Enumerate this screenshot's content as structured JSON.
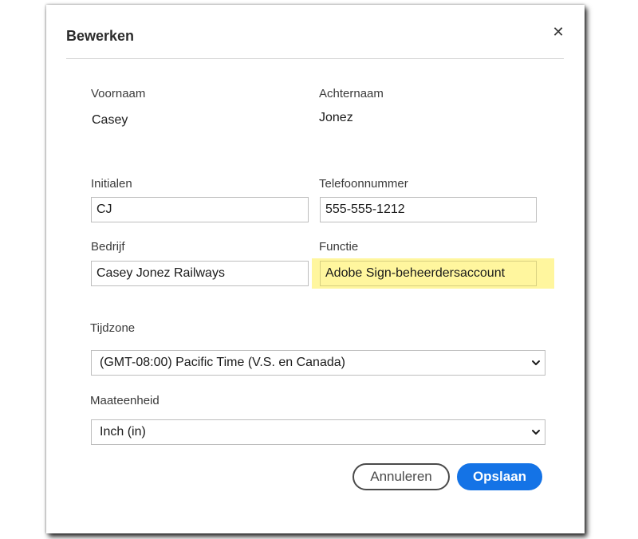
{
  "dialog": {
    "title": "Bewerken",
    "close_glyph": "✕"
  },
  "form": {
    "first_name": {
      "label": "Voornaam",
      "value": "Casey"
    },
    "last_name": {
      "label": "Achternaam",
      "value": "Jonez"
    },
    "initials": {
      "label": "Initialen",
      "value": "CJ"
    },
    "phone": {
      "label": "Telefoonnummer",
      "value": "555-555-1212"
    },
    "company": {
      "label": "Bedrijf",
      "value": "Casey Jonez Railways"
    },
    "job_title": {
      "label": "Functie",
      "value": "Adobe Sign-beheerdersaccount"
    },
    "timezone": {
      "label": "Tijdzone",
      "value": "(GMT-08:00) Pacific Time (V.S. en Canada)"
    },
    "unit": {
      "label": "Maateenheid",
      "value": "Inch (in)"
    }
  },
  "buttons": {
    "cancel_label": "Annuleren",
    "save_label": "Opslaan"
  },
  "colors": {
    "accent": "#1473e6",
    "highlight": "#fff69e"
  },
  "icons": {
    "close": "close-icon",
    "dropdown": "chevron-down-icon"
  }
}
